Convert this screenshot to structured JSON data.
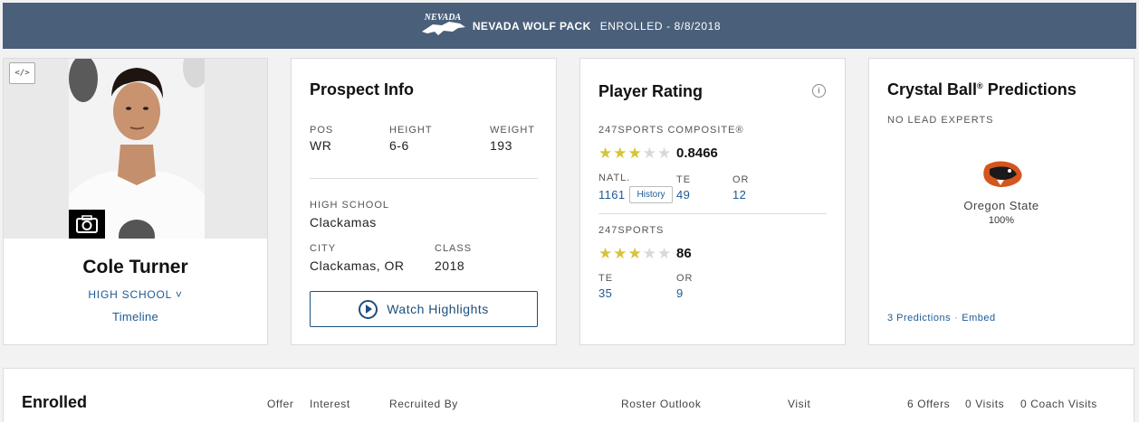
{
  "banner": {
    "logo_icon": "nevada-wolf-logo-icon",
    "logo_text": "NEVADA",
    "team": "NEVADA WOLF PACK",
    "status": "ENROLLED - 8/8/2018",
    "background_color": "#4a5f7a"
  },
  "profile": {
    "embed_label": "</>",
    "name": "Cole Turner",
    "school_toggle": "HIGH SCHOOL ˅",
    "timeline": "Timeline"
  },
  "prospect": {
    "title": "Prospect Info",
    "pos_label": "POS",
    "pos": "WR",
    "height_label": "HEIGHT",
    "height": "6-6",
    "weight_label": "WEIGHT",
    "weight": "193",
    "school_label": "HIGH SCHOOL",
    "school": "Clackamas",
    "city_label": "CITY",
    "city": "Clackamas, OR",
    "class_label": "CLASS",
    "class": "2018",
    "watch_label": "Watch Highlights"
  },
  "rating": {
    "title": "Player Rating",
    "info_label": "i",
    "composite_label": "247SPORTS COMPOSITE®",
    "composite_stars": 3,
    "composite_score": "0.8466",
    "natl_label": "NATL.",
    "natl_rank": "1161",
    "history_label": "History",
    "te_label": "TE",
    "te_rank": "49",
    "or_label": "OR",
    "or_rank": "12",
    "sports_label": "247SPORTS",
    "sports_stars": 3,
    "sports_score": "86",
    "te2_label": "TE",
    "te2_rank": "35",
    "or2_label": "OR",
    "or2_rank": "9",
    "star_color": "#d6c43a"
  },
  "crystal": {
    "title": "Crystal Ball",
    "title_mark": "®",
    "title_suffix": " Predictions",
    "no_lead": "NO LEAD EXPERTS",
    "team_icon": "oregon-state-beaver-icon",
    "team": "Oregon State",
    "pct": "100%",
    "predictions_link": "3 Predictions",
    "sep": "·",
    "embed_link": "Embed"
  },
  "enrolled": {
    "title": "Enrolled",
    "columns": [
      "Offer",
      "Interest",
      "Recruited By",
      "Roster Outlook",
      "Visit"
    ],
    "offers": "6 Offers",
    "visits": "0 Visits",
    "coach_visits": "0 Coach Visits"
  }
}
